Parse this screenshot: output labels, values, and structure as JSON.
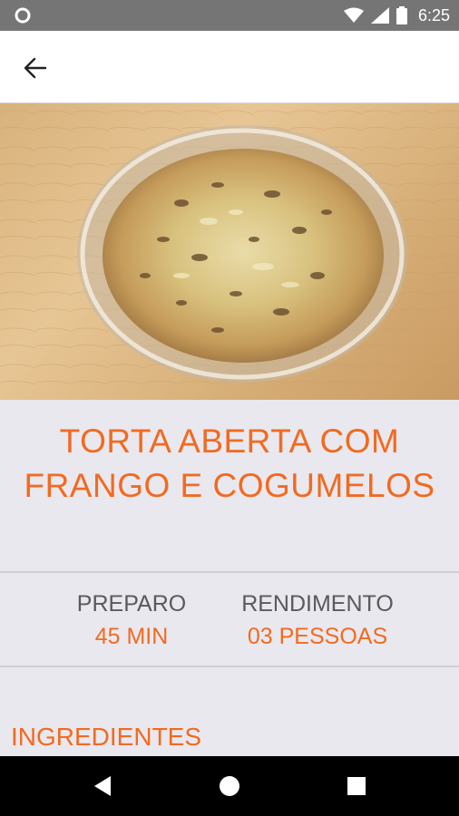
{
  "status_bar": {
    "time": "6:25",
    "icons": [
      "circle-notification-icon",
      "wifi-icon",
      "signal-icon",
      "battery-icon"
    ]
  },
  "app_bar": {
    "back_icon": "arrow-left-icon"
  },
  "recipe": {
    "title_line1": "TORTA ABERTA COM",
    "title_line2": "FRANGO E COGUMELOS",
    "preparo_label": "PREPARO",
    "preparo_value": "45 MIN",
    "rendimento_label": "RENDIMENTO",
    "rendimento_value": "03 PESSOAS",
    "ingredients_heading": "INGREDIENTES"
  },
  "colors": {
    "accent": "#f26a21",
    "background": "#e9e8ee",
    "label_gray": "#5a5a5a",
    "status_bar": "#757575",
    "nav_bar": "#000000"
  },
  "nav_bar": {
    "buttons": [
      "back-triangle-icon",
      "home-circle-icon",
      "recents-square-icon"
    ]
  }
}
